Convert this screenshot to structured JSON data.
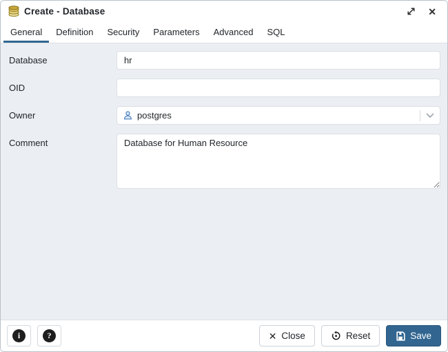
{
  "window": {
    "title": "Create - Database"
  },
  "icons": {
    "close_glyph": "✕",
    "info_glyph": "i",
    "help_glyph": "?",
    "button_close_glyph": "✕"
  },
  "tabs": [
    {
      "label": "General",
      "active": true
    },
    {
      "label": "Definition",
      "active": false
    },
    {
      "label": "Security",
      "active": false
    },
    {
      "label": "Parameters",
      "active": false
    },
    {
      "label": "Advanced",
      "active": false
    },
    {
      "label": "SQL",
      "active": false
    }
  ],
  "form": {
    "fields": [
      {
        "label": "Database",
        "type": "text",
        "value": "hr"
      },
      {
        "label": "OID",
        "type": "text",
        "value": ""
      },
      {
        "label": "Owner",
        "type": "select",
        "value": "postgres"
      },
      {
        "label": "Comment",
        "type": "textarea",
        "value": "Database for Human Resource"
      }
    ]
  },
  "footer": {
    "close_label": "Close",
    "reset_label": "Reset",
    "save_label": "Save"
  },
  "colors": {
    "primary": "#326690",
    "body_bg": "#ebeef2",
    "border": "#dde0e4",
    "icon_gold": "#c9a83a"
  }
}
